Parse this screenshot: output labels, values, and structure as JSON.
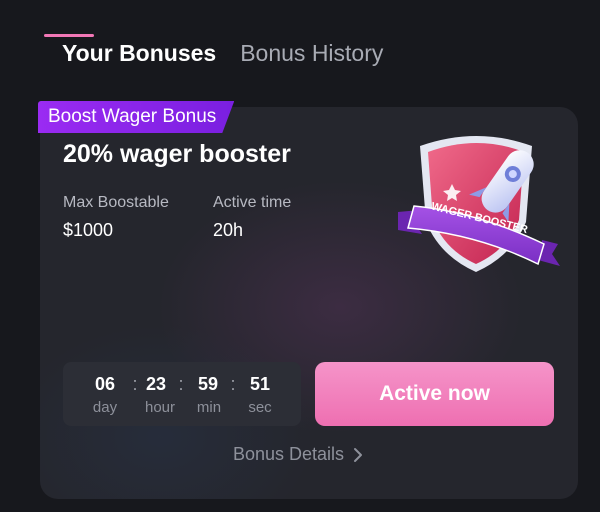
{
  "tabs": [
    {
      "label": "Your Bonuses",
      "active": true
    },
    {
      "label": "Bonus History",
      "active": false
    }
  ],
  "bonus": {
    "ribbon": "Boost Wager Bonus",
    "title": "20% wager booster",
    "max_label": "Max Boostable",
    "max_value": "$1000",
    "time_label": "Active time",
    "time_value": "20h",
    "badge_text": "WAGER BOOSTER"
  },
  "countdown": {
    "day": "06",
    "day_label": "day",
    "hour": "23",
    "hour_label": "hour",
    "min": "59",
    "min_label": "min",
    "sec": "51",
    "sec_label": "sec"
  },
  "actions": {
    "active_label": "Active now",
    "details_label": "Bonus Details"
  },
  "colors": {
    "accent_pink": "#ee6fb1",
    "ribbon_purple": "#9a2bf2",
    "card_bg": "#25262d",
    "page_bg": "#17181d"
  },
  "icons": [
    "wager-booster-badge-icon",
    "chevron-right-icon"
  ]
}
